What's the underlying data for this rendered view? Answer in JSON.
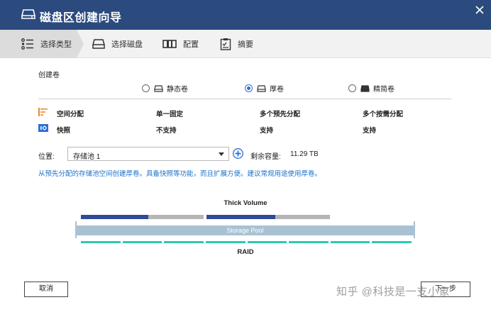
{
  "window": {
    "title": "磁盘区创建向导"
  },
  "steps": [
    {
      "label": "选择类型",
      "icon": "list-icon",
      "active": true
    },
    {
      "label": "选择磁盘",
      "icon": "disk-icon"
    },
    {
      "label": "配置",
      "icon": "config-icon"
    },
    {
      "label": "摘要",
      "icon": "clipboard-icon"
    }
  ],
  "section": {
    "label": "创建卷"
  },
  "volume_types": [
    {
      "label": "静态卷",
      "selected": false
    },
    {
      "label": "厚卷",
      "selected": true
    },
    {
      "label": "精简卷",
      "selected": false
    }
  ],
  "features": [
    {
      "label": "空间分配",
      "icon": "space-allocation-icon",
      "values": [
        "单一固定",
        "多个预先分配",
        "多个按需分配"
      ]
    },
    {
      "label": "快照",
      "icon": "snapshot-icon",
      "values": [
        "不支持",
        "支持",
        "支持"
      ]
    }
  ],
  "location": {
    "label": "位置:",
    "value": "存储池 1"
  },
  "remaining": {
    "label": "剩余容量:",
    "value": "11.29 TB"
  },
  "description": "从预先分配的存储池空间创建厚卷。具备快照等功能，而且扩展方便。建议常规用途使用厚卷。",
  "diagram": {
    "title": "Thick Volume",
    "pool_label": "Storage Pool",
    "raid_label": "RAID",
    "volumes": [
      {
        "allocated_fraction": 0.55
      },
      {
        "allocated_fraction": 0.56
      }
    ],
    "colors": {
      "allocated": "#2e4a99",
      "free": "#b5b5b5",
      "pool": "#a9c2d3",
      "raid": "#2cc9b3"
    }
  },
  "buttons": {
    "cancel": "取消",
    "next": "下一步"
  },
  "watermark": "知乎 @科技是一支小象",
  "colors": {
    "titlebar": "#2b4a7e",
    "link_text": "#1a6fc7",
    "radio_selected": "#2a6fd6"
  }
}
